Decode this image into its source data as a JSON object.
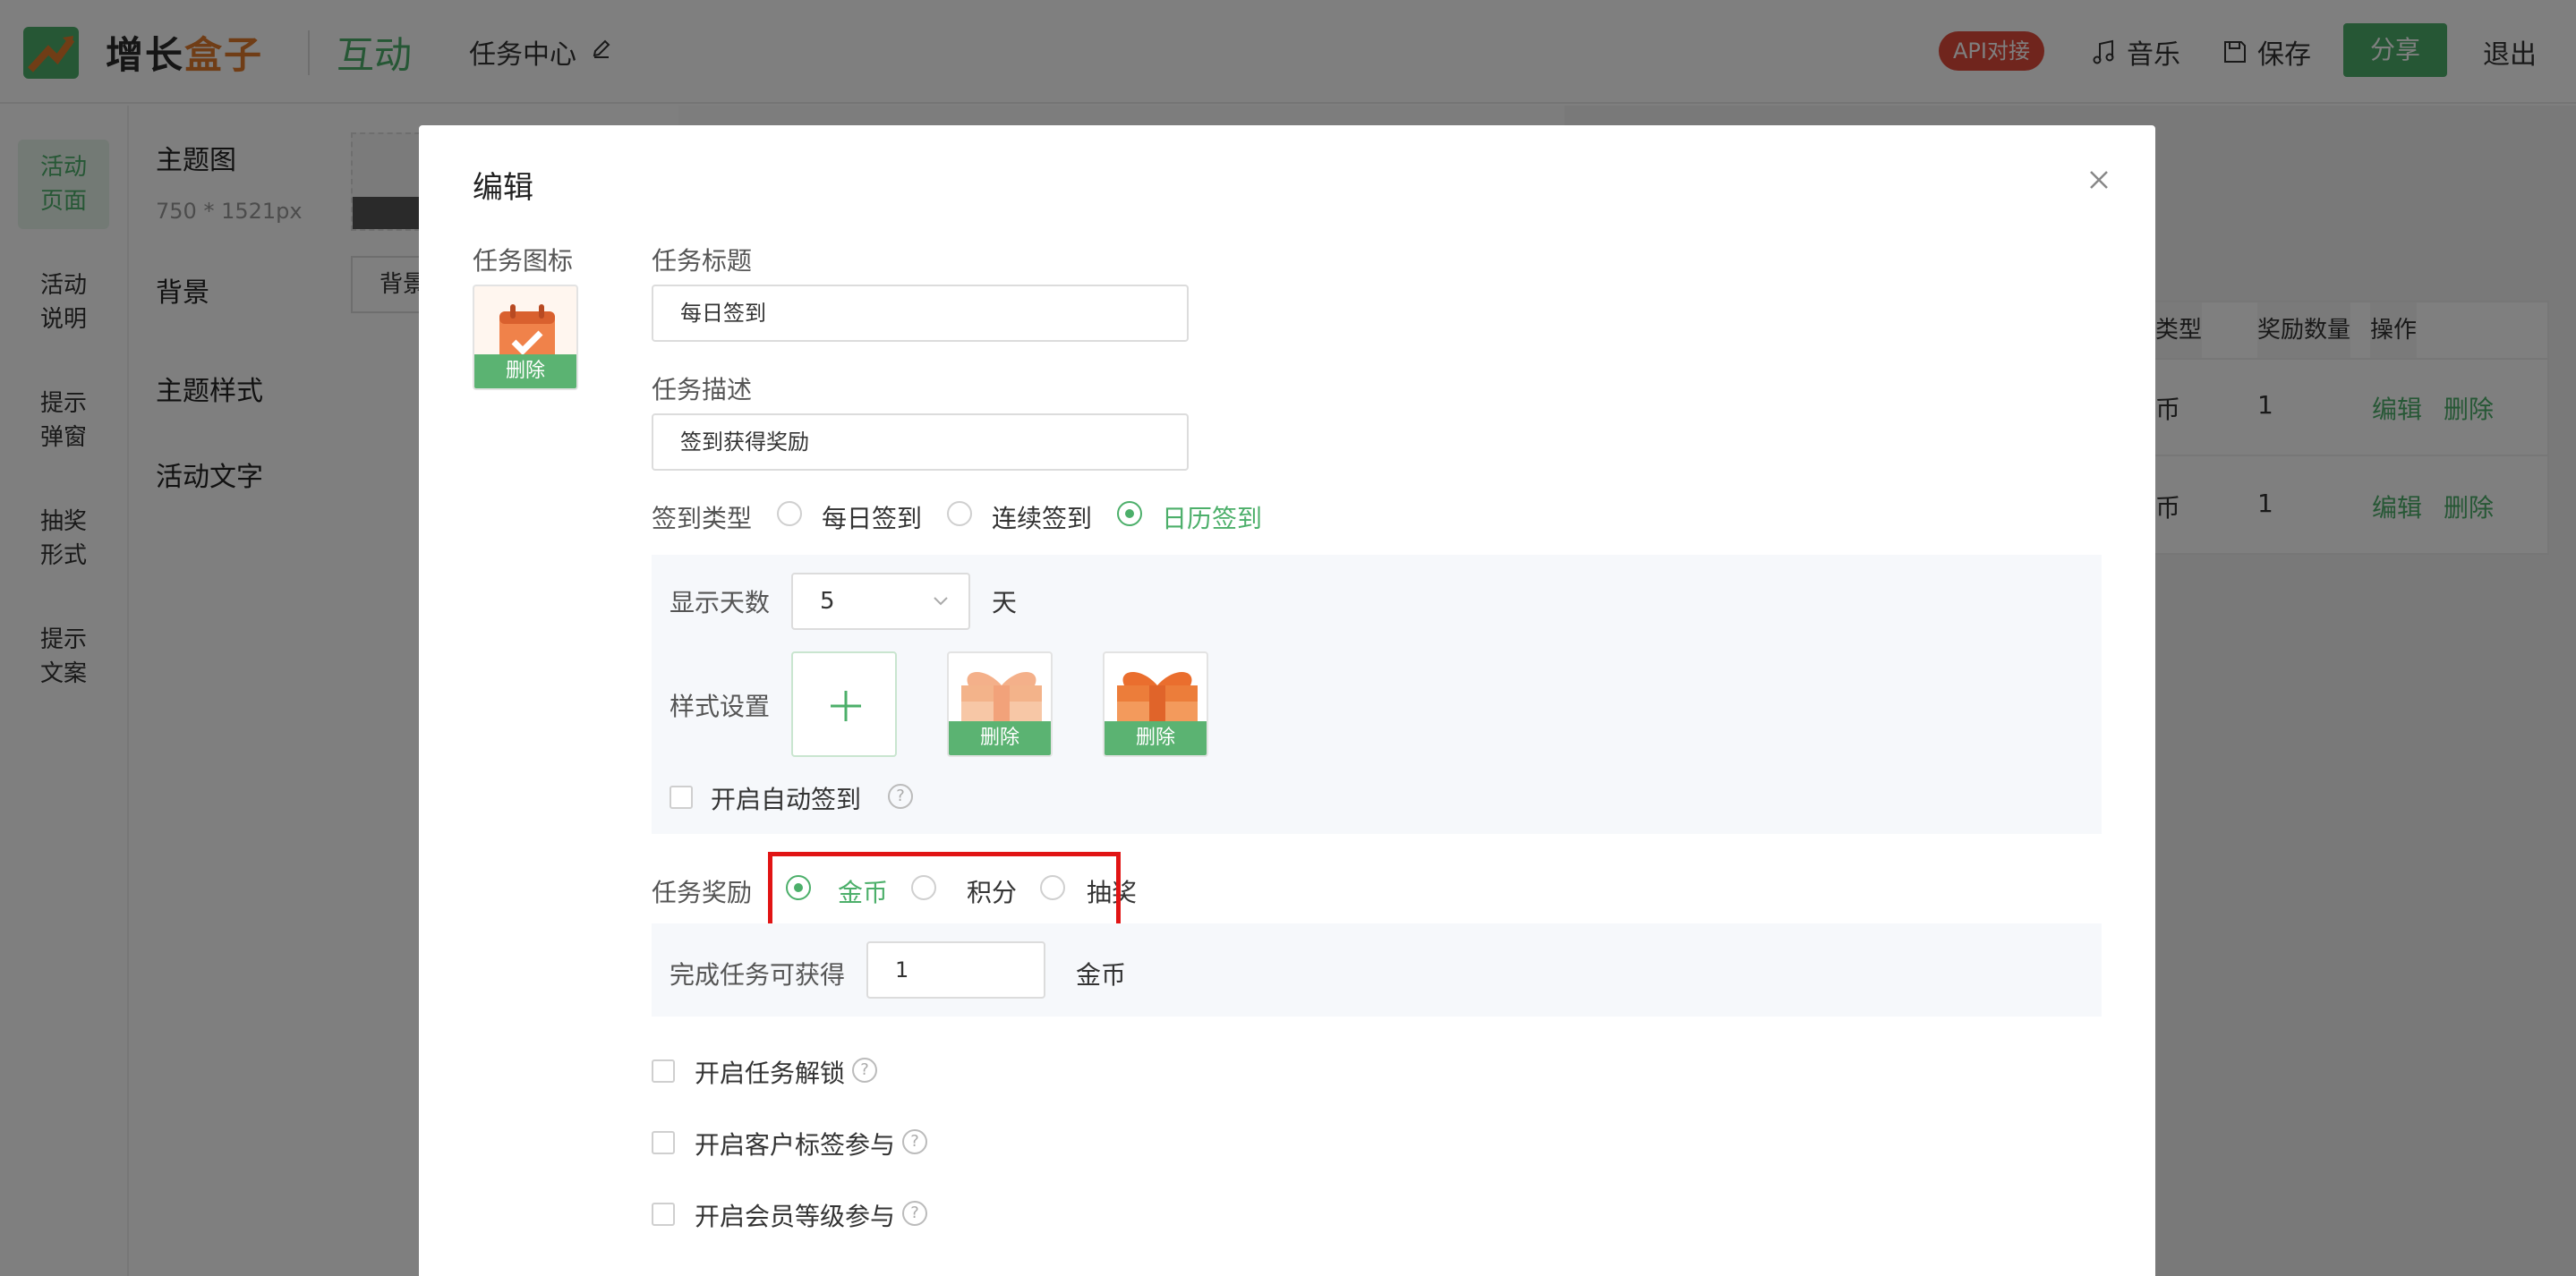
{
  "app": {
    "brand_part1": "增长",
    "brand_part2": "盒子",
    "product": "互动",
    "page_name": "任务中心",
    "api_badge": "API对接",
    "music": "音乐",
    "save": "保存",
    "share": "分享",
    "exit": "退出",
    "colors": {
      "primary": "#4caf6a",
      "brand_orange": "#e07b2c",
      "badge_red": "#e04a3b",
      "highlight_red": "#e11414"
    }
  },
  "leftnav": {
    "items": [
      {
        "label": "活动\n页面",
        "active": true
      },
      {
        "label": "活动\n说明",
        "active": false
      },
      {
        "label": "提示\n弹窗",
        "active": false
      },
      {
        "label": "抽奖\n形式",
        "active": false
      },
      {
        "label": "提示\n文案",
        "active": false
      }
    ]
  },
  "settings": {
    "theme_image": "主题图",
    "theme_size": "750 * 1521px",
    "background": "背景",
    "background_btn": "背景",
    "theme_style": "主题样式",
    "activity_text": "活动文字"
  },
  "table": {
    "headers": [
      "类型",
      "奖励数量",
      "操作"
    ],
    "rows": [
      {
        "type": "币",
        "amount": "1",
        "edit": "编辑",
        "delete": "删除"
      },
      {
        "type": "币",
        "amount": "1",
        "edit": "编辑",
        "delete": "删除"
      }
    ]
  },
  "modal": {
    "title": "编辑",
    "task_icon_label": "任务图标",
    "delete": "删除",
    "task_title_label": "任务标题",
    "task_title_value": "每日签到",
    "task_desc_label": "任务描述",
    "task_desc_value": "签到获得奖励",
    "checkin_type_label": "签到类型",
    "checkin_options": [
      "每日签到",
      "连续签到",
      "日历签到"
    ],
    "checkin_selected": "日历签到",
    "display_days_label": "显示天数",
    "display_days_value": "5",
    "display_days_unit": "天",
    "style_label": "样式设置",
    "auto_checkin_label": "开启自动签到",
    "reward_label": "任务奖励",
    "reward_options": [
      "金币",
      "积分",
      "抽奖"
    ],
    "reward_selected": "金币",
    "complete_label": "完成任务可获得",
    "complete_value": "1",
    "complete_unit": "金币",
    "unlock_label": "开启任务解锁",
    "tag_label": "开启客户标签参与",
    "member_label": "开启会员等级参与",
    "help_mark": "?"
  }
}
